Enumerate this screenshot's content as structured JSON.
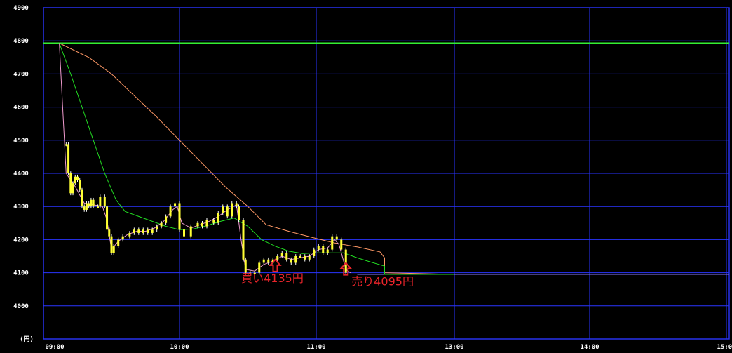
{
  "chart_data": {
    "type": "candlestick",
    "unit_label": "(円)",
    "ylim": [
      3900,
      4900
    ],
    "y_ticks": [
      "4900",
      "4800",
      "4700",
      "4600",
      "4500",
      "4400",
      "4300",
      "4200",
      "4100",
      "4000"
    ],
    "x_ticks": [
      "09:00",
      "10:00",
      "11:00",
      "13:00",
      "14:00",
      "15:00"
    ],
    "grid": true,
    "reference_line": {
      "value": 4793,
      "color": "#33ee33"
    },
    "series": [
      {
        "name": "",
        "kind": "price",
        "color": "#ffff33"
      },
      {
        "name": "",
        "kind": "moving-average-short",
        "color": "#ee99cc"
      },
      {
        "name": "",
        "kind": "moving-average-medium",
        "color": "#22dd22"
      },
      {
        "name": "",
        "kind": "moving-average-long",
        "color": "#ff9966"
      }
    ],
    "price_path": [
      [
        "09:10",
        4488
      ],
      [
        "09:11",
        4400
      ],
      [
        "09:12",
        4340
      ],
      [
        "09:13",
        4370
      ],
      [
        "09:14",
        4390
      ],
      [
        "09:15",
        4380
      ],
      [
        "09:16",
        4350
      ],
      [
        "09:17",
        4300
      ],
      [
        "09:18",
        4290
      ],
      [
        "09:19",
        4310
      ],
      [
        "09:20",
        4300
      ],
      [
        "09:21",
        4320
      ],
      [
        "09:22",
        4300
      ],
      [
        "09:24",
        4300
      ],
      [
        "09:25",
        4330
      ],
      [
        "09:27",
        4300
      ],
      [
        "09:28",
        4230
      ],
      [
        "09:29",
        4210
      ],
      [
        "09:30",
        4160
      ],
      [
        "09:31",
        4180
      ],
      [
        "09:33",
        4200
      ],
      [
        "09:35",
        4210
      ],
      [
        "09:38",
        4220
      ],
      [
        "09:40",
        4230
      ],
      [
        "09:42",
        4220
      ],
      [
        "09:44",
        4230
      ],
      [
        "09:46",
        4220
      ],
      [
        "09:48",
        4230
      ],
      [
        "09:50",
        4240
      ],
      [
        "09:52",
        4250
      ],
      [
        "09:54",
        4270
      ],
      [
        "09:56",
        4300
      ],
      [
        "09:58",
        4310
      ],
      [
        "10:00",
        4230
      ],
      [
        "10:02",
        4210
      ],
      [
        "10:05",
        4240
      ],
      [
        "10:08",
        4250
      ],
      [
        "10:10",
        4240
      ],
      [
        "10:12",
        4260
      ],
      [
        "10:15",
        4250
      ],
      [
        "10:17",
        4280
      ],
      [
        "10:19",
        4300
      ],
      [
        "10:21",
        4270
      ],
      [
        "10:23",
        4310
      ],
      [
        "10:25",
        4300
      ],
      [
        "10:26",
        4260
      ],
      [
        "10:28",
        4140
      ],
      [
        "10:29",
        4100
      ],
      [
        "10:31",
        4100
      ],
      [
        "10:33",
        4100
      ],
      [
        "10:35",
        4130
      ],
      [
        "10:37",
        4140
      ],
      [
        "10:39",
        4130
      ],
      [
        "10:41",
        4140
      ],
      [
        "10:43",
        4150
      ],
      [
        "10:45",
        4160
      ],
      [
        "10:47",
        4140
      ],
      [
        "10:49",
        4130
      ],
      [
        "10:51",
        4150
      ],
      [
        "10:53",
        4150
      ],
      [
        "10:55",
        4140
      ],
      [
        "10:57",
        4150
      ],
      [
        "10:59",
        4170
      ],
      [
        "11:01",
        4180
      ],
      [
        "11:03",
        4160
      ],
      [
        "11:05",
        4170
      ],
      [
        "11:07",
        4210
      ],
      [
        "11:09",
        4200
      ],
      [
        "11:11",
        4170
      ],
      [
        "11:13",
        4100
      ]
    ],
    "ma_short": [
      [
        "09:07",
        4793
      ],
      [
        "09:10",
        4400
      ],
      [
        "09:14",
        4360
      ],
      [
        "09:18",
        4310
      ],
      [
        "09:22",
        4305
      ],
      [
        "09:26",
        4300
      ],
      [
        "09:28",
        4260
      ],
      [
        "09:30",
        4170
      ],
      [
        "09:33",
        4195
      ],
      [
        "09:37",
        4215
      ],
      [
        "09:41",
        4225
      ],
      [
        "09:45",
        4225
      ],
      [
        "09:49",
        4235
      ],
      [
        "09:53",
        4255
      ],
      [
        "09:57",
        4290
      ],
      [
        "09:59",
        4300
      ],
      [
        "10:01",
        4250
      ],
      [
        "10:05",
        4235
      ],
      [
        "10:09",
        4245
      ],
      [
        "10:13",
        4255
      ],
      [
        "10:17",
        4270
      ],
      [
        "10:21",
        4290
      ],
      [
        "10:25",
        4305
      ],
      [
        "10:27",
        4200
      ],
      [
        "10:29",
        4110
      ],
      [
        "10:33",
        4105
      ],
      [
        "10:37",
        4125
      ],
      [
        "10:41",
        4135
      ],
      [
        "10:45",
        4150
      ],
      [
        "10:49",
        4140
      ],
      [
        "10:53",
        4145
      ],
      [
        "10:57",
        4150
      ],
      [
        "11:01",
        4170
      ],
      [
        "11:05",
        4175
      ],
      [
        "11:08",
        4200
      ],
      [
        "11:10",
        4185
      ],
      [
        "11:13",
        4110
      ],
      [
        "11:15",
        4100
      ]
    ],
    "ma_medium": [
      [
        "09:07",
        4793
      ],
      [
        "09:12",
        4700
      ],
      [
        "09:17",
        4600
      ],
      [
        "09:22",
        4500
      ],
      [
        "09:27",
        4400
      ],
      [
        "09:32",
        4320
      ],
      [
        "09:36",
        4285
      ],
      [
        "09:42",
        4270
      ],
      [
        "09:48",
        4255
      ],
      [
        "09:54",
        4240
      ],
      [
        "10:00",
        4230
      ],
      [
        "10:06",
        4232
      ],
      [
        "10:12",
        4242
      ],
      [
        "10:18",
        4255
      ],
      [
        "10:24",
        4265
      ],
      [
        "10:30",
        4240
      ],
      [
        "10:36",
        4200
      ],
      [
        "10:42",
        4180
      ],
      [
        "10:48",
        4165
      ],
      [
        "10:54",
        4158
      ],
      [
        "11:00",
        4160
      ],
      [
        "11:06",
        4160
      ],
      [
        "11:12",
        4160
      ],
      [
        "11:18",
        4145
      ],
      [
        "11:24",
        4132
      ],
      [
        "11:30",
        4120
      ],
      [
        "11:36",
        4100
      ],
      [
        "12:00",
        4095
      ],
      [
        "13:00",
        4095
      ]
    ],
    "ma_long": [
      [
        "09:07",
        4793
      ],
      [
        "09:20",
        4750
      ],
      [
        "09:30",
        4700
      ],
      [
        "09:40",
        4635
      ],
      [
        "09:50",
        4570
      ],
      [
        "10:00",
        4500
      ],
      [
        "10:10",
        4430
      ],
      [
        "10:20",
        4360
      ],
      [
        "10:30",
        4300
      ],
      [
        "10:38",
        4245
      ],
      [
        "10:48",
        4225
      ],
      [
        "10:58",
        4207
      ],
      [
        "11:08",
        4190
      ],
      [
        "11:18",
        4178
      ],
      [
        "11:28",
        4163
      ],
      [
        "11:38",
        4145
      ],
      [
        "11:48",
        4127
      ],
      [
        "11:58",
        4119
      ],
      [
        "12:10",
        4117
      ],
      [
        "12:30",
        4110
      ],
      [
        "12:50",
        4100
      ],
      [
        "13:00",
        4095
      ]
    ],
    "annotations": [
      {
        "text": "買い4135円",
        "time": "10:42",
        "price": 4110
      },
      {
        "text": "売り4095円",
        "time": "11:13",
        "price": 4100
      }
    ]
  }
}
